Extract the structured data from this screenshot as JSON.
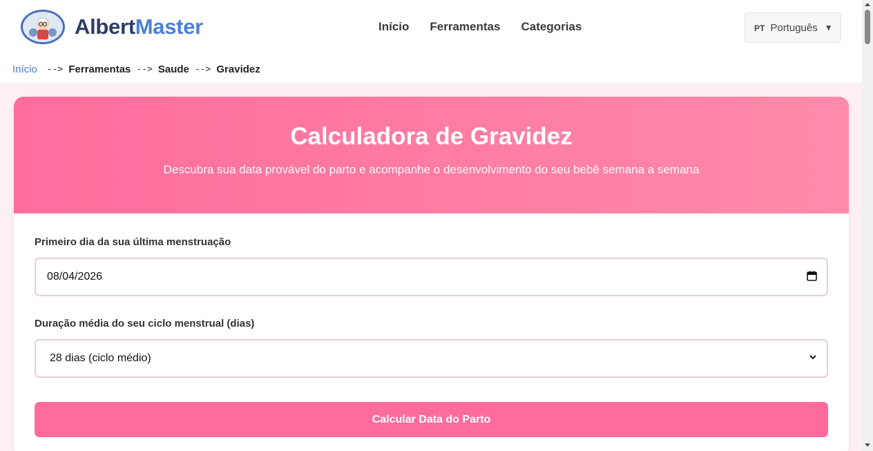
{
  "header": {
    "logo_part1": "Albert",
    "logo_part2": "Master",
    "nav": [
      "Início",
      "Ferramentas",
      "Categorias"
    ],
    "language": {
      "code": "PT",
      "label": "Português"
    }
  },
  "breadcrumb": {
    "items": [
      "Início",
      "Ferramentas",
      "Saude",
      "Gravidez"
    ],
    "separator": "-->"
  },
  "hero": {
    "title": "Calculadora de Gravidez",
    "subtitle": "Descubra sua data provável do parto e acompanhe o desenvolvimento do seu bebê semana a semana"
  },
  "form": {
    "lmp_label": "Primeiro dia da sua última menstruação",
    "lmp_value": "08/04/2026",
    "cycle_label": "Duração média do seu ciclo menstrual (dias)",
    "cycle_value": "28 dias (ciclo médio)",
    "submit_label": "Calcular Data do Parto"
  },
  "colors": {
    "accent": "#ff6b9d",
    "brand_dark": "#2c3e66",
    "brand_light": "#4a7fd8",
    "page_bg": "#fdf0f3"
  },
  "icons": [
    "calendar-icon",
    "chevron-down-icon",
    "caret-down-icon"
  ]
}
